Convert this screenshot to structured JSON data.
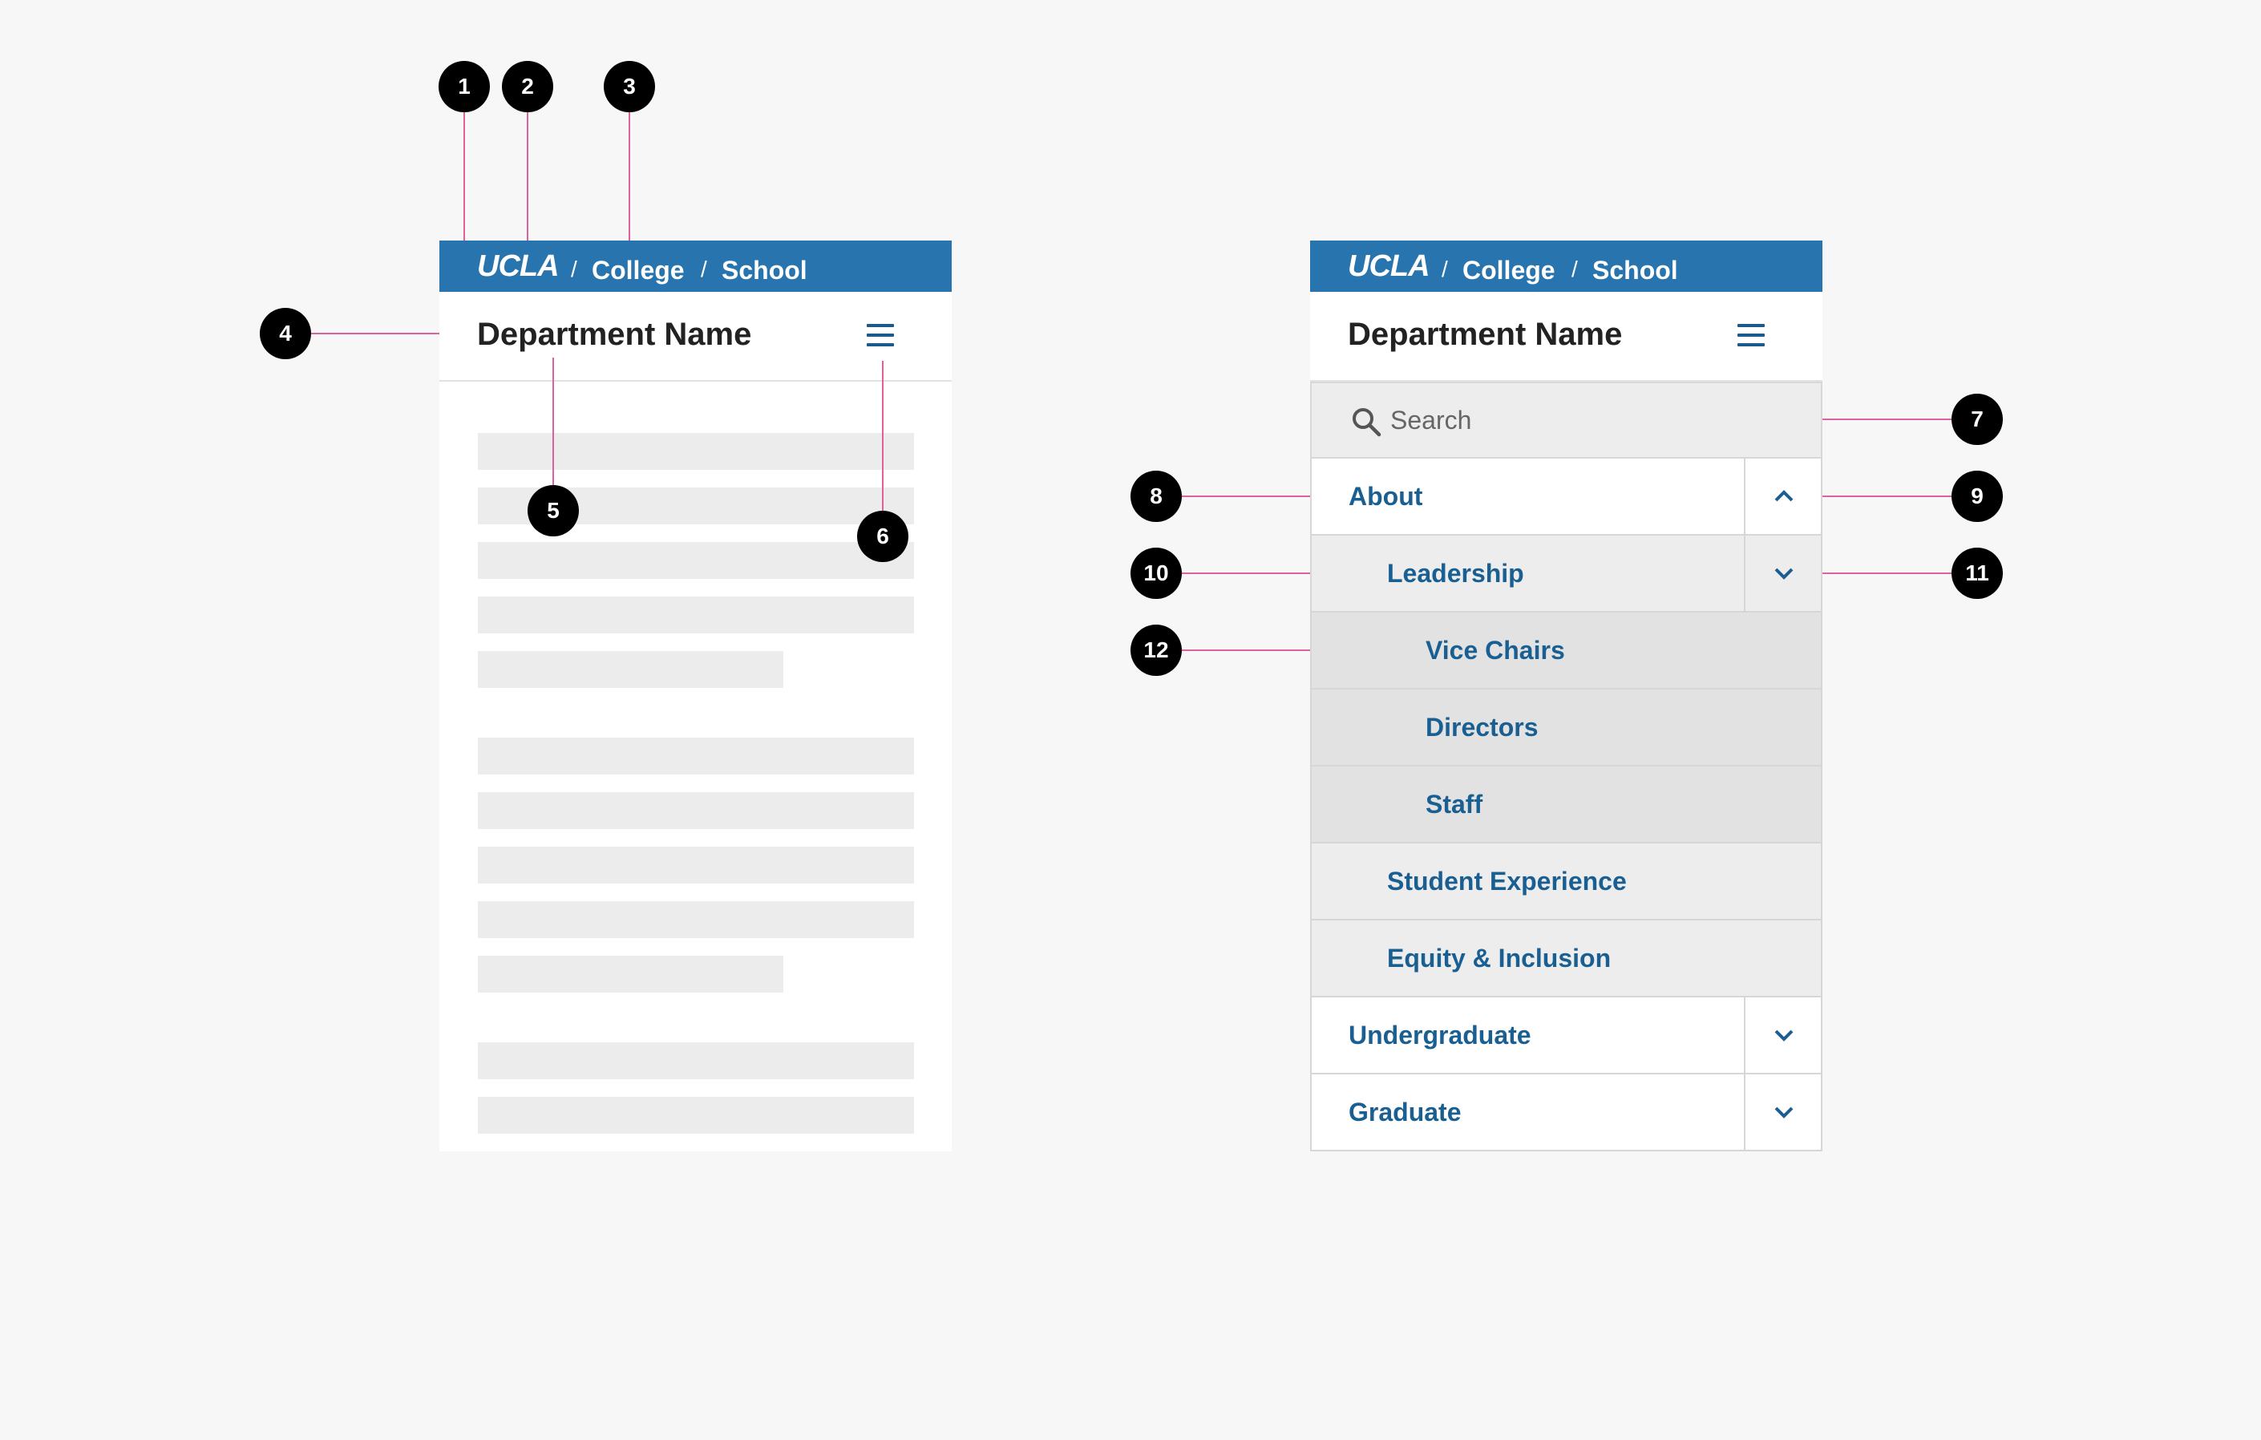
{
  "brand": {
    "logo_text": "UCLA",
    "primary_color": "#2774ae",
    "link_color": "#1a5f92",
    "annotation_line_color": "#e0609e"
  },
  "breadcrumb": {
    "separator": "/",
    "items": [
      "College",
      "School"
    ]
  },
  "header": {
    "department_name": "Department Name",
    "menu_icon": "hamburger-icon"
  },
  "search": {
    "placeholder": "Search",
    "icon": "search-icon"
  },
  "nav": {
    "items": [
      {
        "label": "About",
        "level": 1,
        "toggle": "chevron-up-icon",
        "expanded": true
      },
      {
        "label": "Leadership",
        "level": 2,
        "toggle": "chevron-down-icon",
        "expanded": true
      },
      {
        "label": "Vice Chairs",
        "level": 3
      },
      {
        "label": "Directors",
        "level": 3
      },
      {
        "label": "Staff",
        "level": 3
      },
      {
        "label": "Student Experience",
        "level": 2
      },
      {
        "label": "Equity & Inclusion",
        "level": 2
      },
      {
        "label": "Undergraduate",
        "level": 1,
        "toggle": "chevron-down-icon",
        "expanded": false
      },
      {
        "label": "Graduate",
        "level": 1,
        "toggle": "chevron-down-icon",
        "expanded": false
      }
    ]
  },
  "callouts": [
    "1",
    "2",
    "3",
    "4",
    "5",
    "6",
    "7",
    "8",
    "9",
    "10",
    "11",
    "12"
  ]
}
